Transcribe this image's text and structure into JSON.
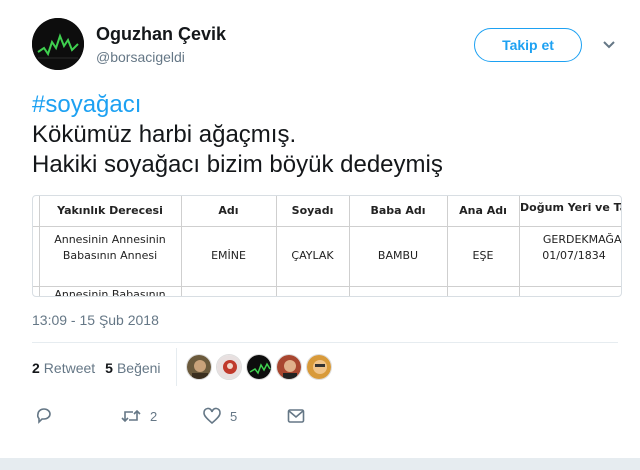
{
  "author": {
    "name": "Oguzhan Çevik",
    "handle": "@borsacigeldi"
  },
  "follow_button": {
    "label": "Takip et"
  },
  "tweet": {
    "hashtag": "#soyağacı",
    "line1": "Kökümüz harbi ağaçmış.",
    "line2": "Hakiki soyağacı bizim böyük dedeymiş"
  },
  "media_table": {
    "headers": [
      "Yakınlık Derecesi",
      "Adı",
      "Soyadı",
      "Baba Adı",
      "Ana Adı",
      "Doğum Yeri ve Tarihi"
    ],
    "row1": {
      "relation_line1": "Annesinin Annesinin",
      "relation_line2": "Babasının Annesi",
      "name": "EMİNE",
      "surname": "ÇAYLAK",
      "father": "BAMBU",
      "mother": "EŞE",
      "birth_line1": "GERDEKMAĞAR",
      "birth_line2": "01/07/1834"
    },
    "row2_partial": "Annesinin Babasının"
  },
  "timestamp": "13:09 - 15 Şub 2018",
  "stats": {
    "retweets_count": "2",
    "retweets_label": "Retweet",
    "likes_count": "5",
    "likes_label": "Beğeni"
  },
  "actions": {
    "retweet_count": "2",
    "like_count": "5"
  },
  "colors": {
    "accent": "#1da1f2",
    "muted": "#657786",
    "divider": "#e6ecf0"
  }
}
